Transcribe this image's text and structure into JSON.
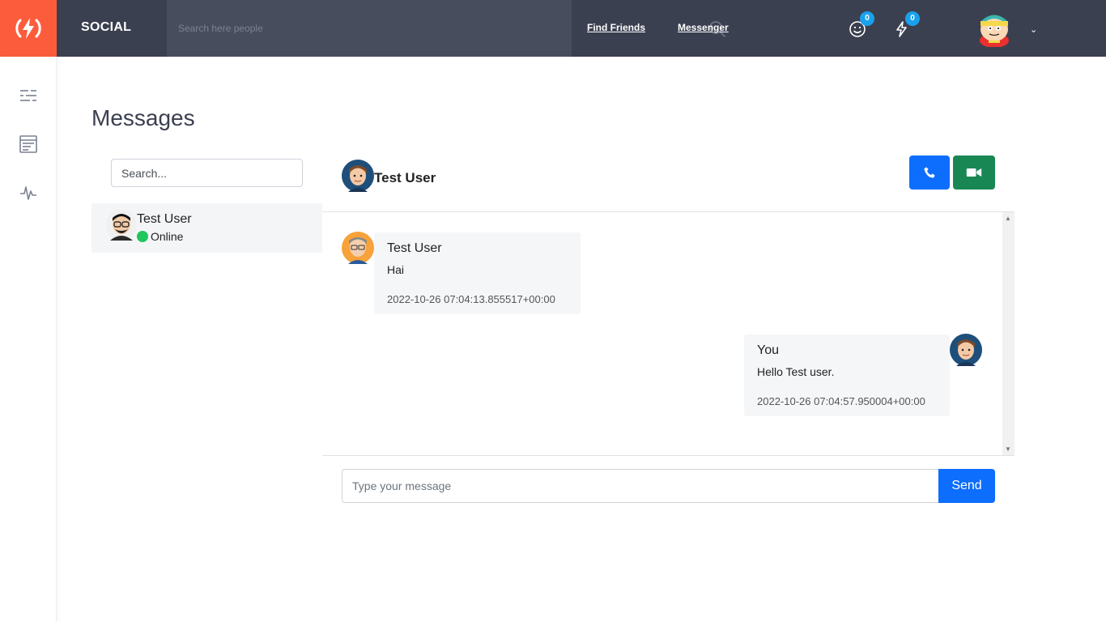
{
  "header": {
    "brand": "SOCIAL",
    "search_placeholder": "Search here people",
    "nav": [
      {
        "label": "Find Friends"
      },
      {
        "label": "Messenger"
      }
    ],
    "badges": {
      "friend_requests": "0",
      "notifications": "0"
    },
    "logo_icon": "bolt-logo-icon",
    "colors": {
      "header_bg": "#3b4050",
      "logo_bg": "#fd5c3c",
      "badge": "#1aa1ee"
    }
  },
  "sidebar": {
    "icons": [
      "list-icon",
      "news-feed-icon",
      "activity-icon"
    ]
  },
  "page": {
    "title": "Messages"
  },
  "contacts": {
    "search_placeholder": "Search...",
    "items": [
      {
        "name": "Test User",
        "status": "Online"
      }
    ]
  },
  "chat": {
    "header_name": "Test User",
    "messages": [
      {
        "sender": "Test User",
        "text": "Hai",
        "time": "2022-10-26 07:04:13.855517+00:00",
        "side": "left"
      },
      {
        "sender": "You",
        "text": "Hello Test user.",
        "time": "2022-10-26 07:04:57.950004+00:00",
        "side": "right"
      }
    ],
    "input_placeholder": "Type your message",
    "send_label": "Send",
    "colors": {
      "call": "#0d6efd",
      "video": "#198754",
      "online": "#22c55e"
    }
  }
}
